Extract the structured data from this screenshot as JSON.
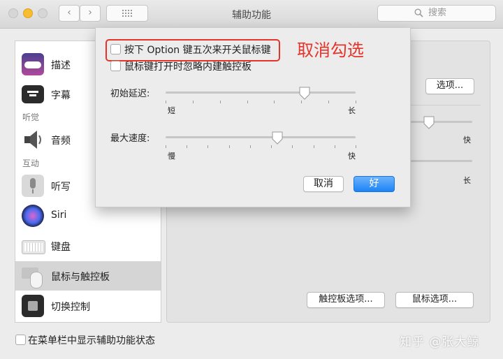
{
  "window": {
    "title": "辅助功能"
  },
  "toolbar": {
    "back": "‹",
    "forward": "›",
    "search_placeholder": "搜索"
  },
  "sidebar": {
    "items": [
      {
        "label": "描述",
        "icon": "description-icon",
        "selected": false
      },
      {
        "label": "字幕",
        "icon": "captions-icon",
        "selected": false
      },
      {
        "label": "音频",
        "icon": "speaker-icon",
        "selected": false
      },
      {
        "label": "听写",
        "icon": "microphone-icon",
        "selected": false
      },
      {
        "label": "Siri",
        "icon": "siri-icon",
        "selected": false
      },
      {
        "label": "键盘",
        "icon": "keyboard-icon",
        "selected": false
      },
      {
        "label": "鼠标与触控板",
        "icon": "mouse-icon",
        "selected": true
      },
      {
        "label": "切换控制",
        "icon": "switch-control-icon",
        "selected": false
      }
    ],
    "headers": {
      "hearing": "听觉",
      "interaction": "互动"
    }
  },
  "panel": {
    "options_button": "选项...",
    "bg_fast_label_1": "快",
    "bg_long_label": "长",
    "trackpad_options_button": "触控板选项...",
    "mouse_options_button": "鼠标选项..."
  },
  "bottom": {
    "show_in_menubar_label": "在菜单栏中显示辅助功能状态",
    "show_in_menubar_checked": false
  },
  "sheet": {
    "option_key_label": "按下 Option 键五次来开关鼠标键",
    "option_key_checked": false,
    "ignore_trackpad_label": "鼠标键打开时忽略内建触控板",
    "ignore_trackpad_checked": false,
    "annotation": "取消勾选",
    "initial_delay": {
      "label": "初始延迟:",
      "min_label": "短",
      "max_label": "长",
      "value": 0.73,
      "ticks": 8
    },
    "max_speed": {
      "label": "最大速度:",
      "min_label": "慢",
      "max_label": "快",
      "value": 0.59,
      "ticks": 10
    },
    "cancel_button": "取消",
    "ok_button": "好"
  },
  "watermark": "知乎 @张大鲸",
  "colors": {
    "annotation": "#e5342a",
    "primary_button": "#1c83f5",
    "selected_row": "#d5d5d5"
  }
}
